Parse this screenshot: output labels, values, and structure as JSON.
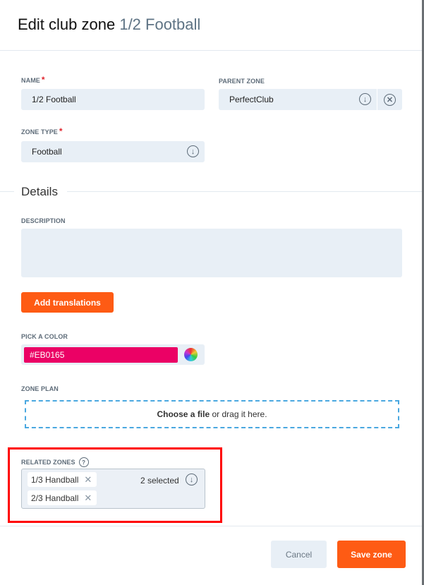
{
  "header": {
    "title": "Edit club zone",
    "zone_name": "1/2 Football"
  },
  "form": {
    "name": {
      "label": "NAME",
      "required": "*",
      "value": "1/2 Football"
    },
    "parent_zone": {
      "label": "PARENT ZONE",
      "value": "PerfectClub"
    },
    "zone_type": {
      "label": "ZONE TYPE",
      "required": "*",
      "value": "Football"
    },
    "details_heading": "Details",
    "description": {
      "label": "DESCRIPTION",
      "value": ""
    },
    "add_translations": "Add translations",
    "color": {
      "label": "PICK A COLOR",
      "value": "#EB0165",
      "swatch": "#EB0165"
    },
    "zone_plan": {
      "label": "ZONE PLAN",
      "choose": "Choose a file",
      "drag": " or drag it here."
    },
    "related_zones": {
      "label": "RELATED ZONES",
      "help": "?",
      "chips": [
        "1/3 Handball",
        "2/3 Handball"
      ],
      "remove": "✕",
      "count": "2 selected"
    }
  },
  "footer": {
    "cancel": "Cancel",
    "save": "Save zone"
  },
  "colors": {
    "accent": "#FE5B14",
    "highlight": "#FF0000",
    "dropzone_border": "#4AA8E0"
  }
}
